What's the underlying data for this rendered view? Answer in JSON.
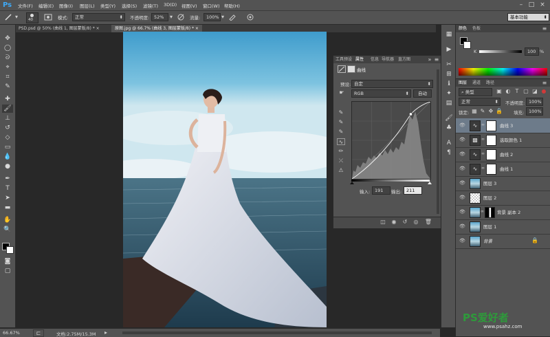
{
  "app": {
    "logo": "Ps",
    "search_icon": "search-icon"
  },
  "menu": [
    "文件(F)",
    "编辑(E)",
    "图像(I)",
    "图层(L)",
    "类型(Y)",
    "选择(S)",
    "滤镜(T)",
    "3D(D)",
    "视图(V)",
    "窗口(W)",
    "帮助(H)"
  ],
  "window_controls": {
    "minimize": "–",
    "maximize": "□",
    "close": "×"
  },
  "options": {
    "brush_size": "40",
    "mode_label": "模式:",
    "mode_value": "正常",
    "opacity_label": "不透明度:",
    "opacity_value": "52%",
    "flow_label": "流量:",
    "flow_value": "100%",
    "workspace": "基本功能"
  },
  "tabs": [
    {
      "label": "PSD.psd @ 50% (曲线 1, 图层蒙版/8) *"
    },
    {
      "label": "原图.jpg @ 66.7% (曲线 3, 图层蒙版/8) *"
    }
  ],
  "status": {
    "zoom": "66.67%",
    "doc": "文档:2.75M/15.3M"
  },
  "properties": {
    "tabs": [
      "工具预设",
      "属性",
      "信息",
      "导航器",
      "直方图"
    ],
    "title": "曲线",
    "preset_label": "预设:",
    "preset_value": "自定",
    "channel_value": "RGB",
    "auto_label": "自动",
    "input_label": "输入:",
    "input_value": "191",
    "output_label": "输出:",
    "output_value": "211"
  },
  "color_panel": {
    "tabs": [
      "颜色",
      "色板"
    ],
    "k_label": "K",
    "k_value": "100",
    "pct": "%"
  },
  "layers_panel": {
    "tabs": [
      "图层",
      "通道",
      "路径"
    ],
    "filter_value": "类型",
    "blend_value": "正常",
    "opacity_label": "不透明度:",
    "opacity_value": "100%",
    "lock_label": "锁定:",
    "fill_label": "填充:",
    "fill_value": "100%",
    "layers": [
      {
        "name": "曲线 3",
        "type": "adj",
        "selected": true
      },
      {
        "name": "选取颜色 1",
        "type": "adj2",
        "selected": false
      },
      {
        "name": "曲线 2",
        "type": "adj",
        "selected": false
      },
      {
        "name": "曲线 1",
        "type": "adj",
        "selected": false
      },
      {
        "name": "图层 3",
        "type": "photo",
        "selected": false
      },
      {
        "name": "图层 2",
        "type": "trans",
        "selected": false
      },
      {
        "name": "背景 副本 2",
        "type": "photomask",
        "selected": false
      },
      {
        "name": "图层 1",
        "type": "photo",
        "selected": false
      },
      {
        "name": "背景",
        "type": "photolock",
        "selected": false
      }
    ]
  },
  "watermark": {
    "brand": "PS爱好者",
    "url": "www.psahz.com"
  },
  "colors": {
    "accent": "#3fa9f5",
    "panel": "#535353",
    "bg": "#282828",
    "selected_layer": "#6d7b8a"
  }
}
